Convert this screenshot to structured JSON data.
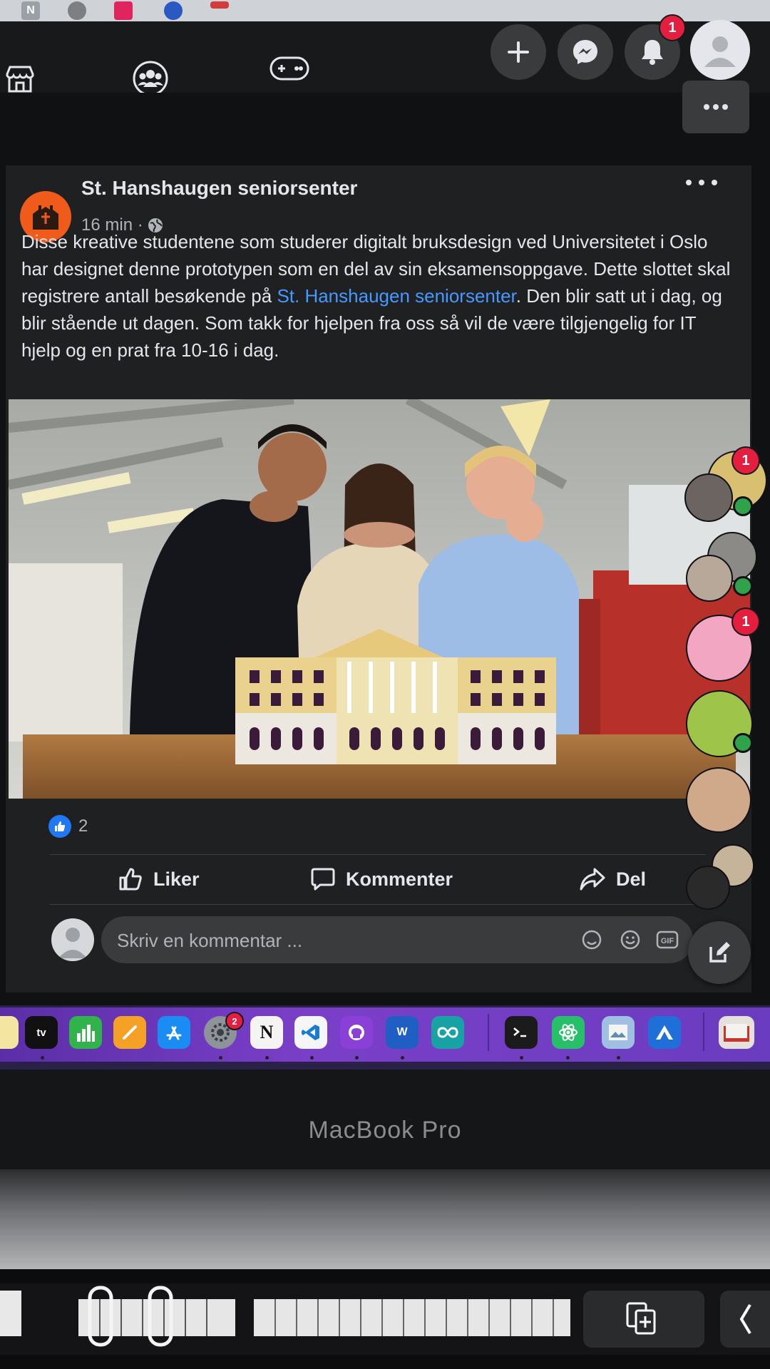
{
  "header": {
    "tab_favicon_letter": "N",
    "notifications_count": "1"
  },
  "post": {
    "page_name": "St. Hanshaugen seniorsenter",
    "time": "16 min ·",
    "text_part1": "Disse kreative studentene som studerer digitalt bruksdesign ved Universitetet i Oslo har designet denne prototypen som en del av sin eksamensoppgave. Dette slottet skal registrere antall besøkende på ",
    "text_link": "St. Hanshaugen seniorsenter",
    "text_part2": ". Den blir satt ut i dag, og blir stående ut dagen. Som takk for hjelpen fra oss så vil de være tilgjengelig for IT hjelp og en prat fra 10-16 i dag.",
    "reaction_count": "2"
  },
  "actions": {
    "like": "Liker",
    "comment": "Kommenter",
    "share": "Del"
  },
  "comment": {
    "placeholder": "Skriv en kommentar ..."
  },
  "contacts_badges": [
    "1",
    "1"
  ],
  "dock": {
    "settings_badge": "2",
    "appletv_label": "tv",
    "notion_label": "N",
    "word_label": "W"
  },
  "laptop": {
    "model_label": "MacBook Pro"
  },
  "colors": {
    "accent_link": "#4599ff",
    "page_avatar": "#f05a1a",
    "badge": "#e41e3f",
    "online": "#31a24c"
  }
}
